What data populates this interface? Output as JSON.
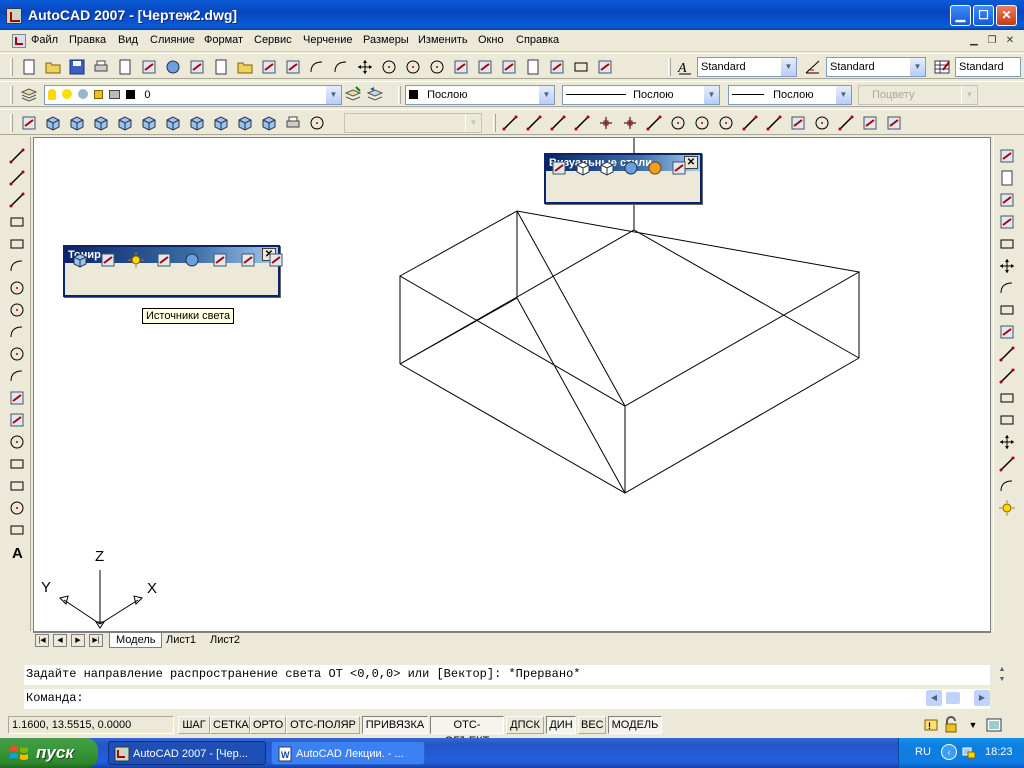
{
  "window": {
    "title": "AutoCAD 2007 - [Чертеж2.dwg]"
  },
  "menu": [
    "Файл",
    "Правка",
    "Вид",
    "Слияние",
    "Формат",
    "Сервис",
    "Черчение",
    "Размеры",
    "Изменить",
    "Окно",
    "Справка"
  ],
  "toolbar_styles": {
    "text_style": "Standard",
    "dim_style": "Standard",
    "table_style": "Standard"
  },
  "layers": {
    "current_layer": "0",
    "color": "Послою",
    "linetype": "Послою",
    "lineweight": "Послою",
    "plot_style": "Поцвету"
  },
  "float_toolbars": {
    "render": {
      "title": "Тонир",
      "tooltip": "Источники света"
    },
    "visual_styles": {
      "title": "Визуальные стили"
    }
  },
  "ucs": {
    "x": "X",
    "y": "Y",
    "z": "Z"
  },
  "layout_tabs": [
    "Модель",
    "Лист1",
    "Лист2"
  ],
  "command": {
    "history_line": "Задайте направление распространение света ОТ <0,0,0> или [Вектор]: *Прервано*",
    "prompt": "Команда:"
  },
  "status": {
    "coords": "1.1600, 13.5515, 0.0000",
    "buttons": [
      "ШАГ",
      "СЕТКА",
      "ОРТО",
      "ОТС-ПОЛЯР",
      "ПРИВЯЗКА",
      "ОТС-ОБЪЕКТ",
      "ДПСК",
      "ДИН",
      "ВЕС",
      "МОДЕЛЬ"
    ]
  },
  "taskbar": {
    "start": "пуск",
    "items": [
      "AutoCAD 2007 - [Чер...",
      "AutoCAD Лекции. - ..."
    ],
    "lang": "RU",
    "clock": "18:23"
  },
  "colors": {
    "titlebar": "#0a5bd6",
    "float_title": "#0a246a",
    "canvas": "#ffffff",
    "start_button": "#3a9a3a",
    "taskbar": "#245edc"
  }
}
